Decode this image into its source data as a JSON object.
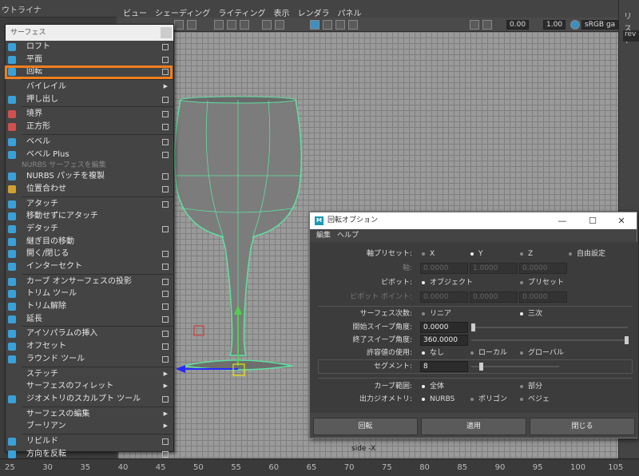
{
  "outliner": {
    "title": "ウトライナ"
  },
  "viewport": {
    "menus": [
      "ビュー",
      "シェーディング",
      "ライティング",
      "表示",
      "レンダラ",
      "パネル"
    ],
    "toolbar": {
      "value1": "0.00",
      "value2": "1.00",
      "colorspace": "sRGB ga"
    },
    "camera_label": "side -X"
  },
  "right_panel": {
    "title": "リスト",
    "field": "rev"
  },
  "timeline": {
    "ticks": [
      "25",
      "30",
      "35",
      "40",
      "45",
      "50",
      "55",
      "60",
      "65",
      "70",
      "75",
      "80",
      "85",
      "90",
      "95",
      "100",
      "105"
    ]
  },
  "surface_menu": {
    "title": "サーフェス",
    "section_label": "NURBS サーフェスを編集",
    "items": [
      {
        "label": "ロフト",
        "opt": true
      },
      {
        "label": "平面",
        "opt": true
      },
      {
        "label": "回転",
        "opt": true
      },
      {
        "label": "バイレイル",
        "arrow": true
      },
      {
        "label": "押し出し",
        "opt": true
      },
      {
        "label": "境界",
        "opt": true
      },
      {
        "label": "正方形",
        "opt": true
      },
      {
        "label": "ベベル",
        "opt": true
      },
      {
        "label": "ベベル Plus",
        "opt": true
      },
      {
        "label": "NURBS パッチを複製",
        "opt": true
      },
      {
        "label": "位置合わせ",
        "opt": true
      },
      {
        "label": "アタッチ",
        "opt": true
      },
      {
        "label": "移動せずにアタッチ",
        "opt": false
      },
      {
        "label": "デタッチ",
        "opt": true
      },
      {
        "label": "継ぎ目の移動",
        "opt": false
      },
      {
        "label": "開く/閉じる",
        "opt": true
      },
      {
        "label": "インターセクト",
        "opt": true
      },
      {
        "label": "カーブ オンサーフェスの投影",
        "opt": true
      },
      {
        "label": "トリム ツール",
        "opt": true
      },
      {
        "label": "トリム解除",
        "opt": true
      },
      {
        "label": "延長",
        "opt": true
      },
      {
        "label": "アイソパラムの挿入",
        "opt": true
      },
      {
        "label": "オフセット",
        "opt": true
      },
      {
        "label": "ラウンド ツール",
        "opt": true
      },
      {
        "label": "ステッチ",
        "arrow": true
      },
      {
        "label": "サーフェスのフィレット",
        "arrow": true
      },
      {
        "label": "ジオメトリのスカルプト ツール",
        "opt": true
      },
      {
        "label": "サーフェスの編集",
        "arrow": true
      },
      {
        "label": "ブーリアン",
        "arrow": true
      },
      {
        "label": "リビルド",
        "opt": true
      },
      {
        "label": "方向を反転",
        "opt": true
      }
    ]
  },
  "revolve_dialog": {
    "title": "回転オプション",
    "menus": [
      "編集",
      "ヘルプ"
    ],
    "axis_preset": {
      "label": "軸プリセット:",
      "options": [
        "X",
        "Y",
        "Z",
        "自由設定"
      ],
      "selected": "Y"
    },
    "axis": {
      "label": "軸:",
      "values": [
        "0.0000",
        "1.0000",
        "0.0000"
      ]
    },
    "pivot": {
      "label": "ピボット:",
      "options": [
        "オブジェクト",
        "プリセット"
      ],
      "selected": "オブジェクト"
    },
    "pivot_point": {
      "label": "ピボット ポイント:",
      "values": [
        "0.0000",
        "0.0000",
        "0.0000"
      ]
    },
    "surface_degree": {
      "label": "サーフェス次数:",
      "options": [
        "リニア",
        "三次"
      ],
      "selected": "三次"
    },
    "start_sweep": {
      "label": "開始スイープ角度:",
      "value": "0.0000"
    },
    "end_sweep": {
      "label": "終了スイープ角度:",
      "value": "360.0000"
    },
    "use_tolerance": {
      "label": "許容値の使用:",
      "options": [
        "なし",
        "ローカル",
        "グローバル"
      ],
      "selected": "なし"
    },
    "segments": {
      "label": "セグメント:",
      "value": "8"
    },
    "curve_range": {
      "label": "カーブ範囲:",
      "options": [
        "全体",
        "部分"
      ],
      "selected": "全体"
    },
    "output_geometry": {
      "label": "出力ジオメトリ:",
      "options": [
        "NURBS",
        "ポリゴン",
        "ベジェ"
      ],
      "selected": "NURBS"
    },
    "buttons": {
      "revolve": "回転",
      "apply": "適用",
      "close": "閉じる"
    }
  }
}
